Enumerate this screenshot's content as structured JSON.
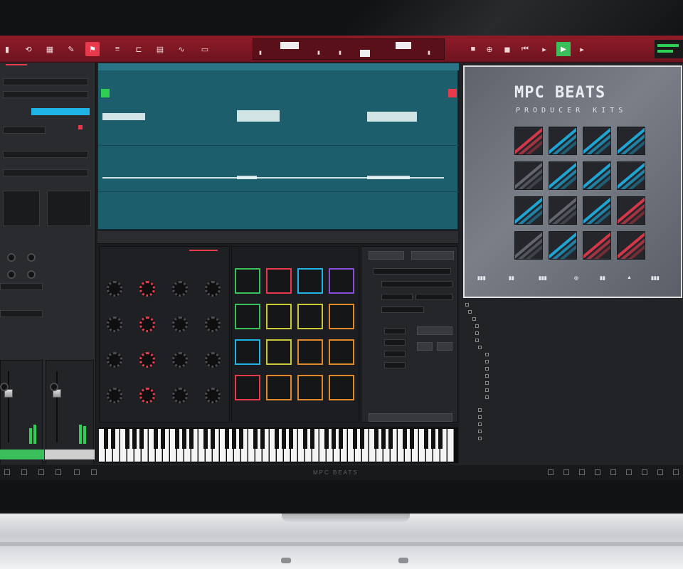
{
  "app": {
    "name": "MPC BEATS"
  },
  "colors": {
    "toolbar_red": "#8f1b27",
    "accent_red": "#e83a4b",
    "accent_cyan": "#1fb4e6",
    "play_green": "#3bbf5a",
    "arrange_teal": "#1c5e6b"
  },
  "toolbar": {
    "icons": [
      "loop-icon",
      "grid-icon",
      "pencil-icon",
      "marker-icon",
      "list-icon",
      "bracket-icon",
      "track-icon",
      "wave-icon",
      "folder-icon"
    ],
    "transport_icons": [
      "record-icon",
      "overdub-icon",
      "stop-icon",
      "rewind-icon",
      "play-icon",
      "play-start-icon"
    ]
  },
  "artwork": {
    "title": "MPC BEATS",
    "subtitle": "PRODUCER KITS"
  },
  "status": {
    "brand": "MPC BEATS"
  }
}
